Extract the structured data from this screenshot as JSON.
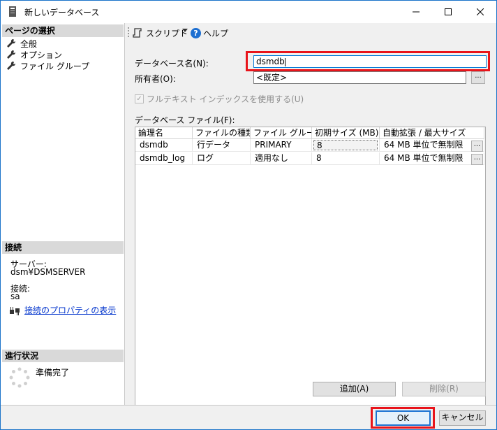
{
  "window": {
    "title": "新しいデータベース",
    "accent_color": "#1a73c9",
    "highlight_color": "#e8141b"
  },
  "left_pane": {
    "page_select_header": "ページの選択",
    "pages": [
      {
        "label": "全般",
        "icon": "wrench-icon"
      },
      {
        "label": "オプション",
        "icon": "wrench-icon"
      },
      {
        "label": "ファイル グループ",
        "icon": "wrench-icon"
      }
    ],
    "connection_header": "接続",
    "server_label": "サーバー:",
    "server_value": "dsm¥DSMSERVER",
    "connection_label": "接続:",
    "connection_value": "sa",
    "connection_properties_link": "接続のプロパティの表示",
    "progress_header": "進行状況",
    "progress_status": "準備完了"
  },
  "toolbar": {
    "script_label": "スクリプト",
    "help_label": "ヘルプ",
    "help_glyph": "?"
  },
  "form": {
    "db_name_label": "データベース名(N):",
    "db_name_value": "dsmdb",
    "owner_label": "所有者(O):",
    "owner_value": "<既定>",
    "browse_glyph": "...",
    "fulltext_label": "フルテキスト インデックスを使用する(U)",
    "fulltext_checked": true,
    "db_files_label": "データベース ファイル(F):"
  },
  "grid": {
    "columns": [
      "論理名",
      "ファイルの種類",
      "ファイル グループ",
      "初期サイズ (MB)",
      "自動拡張 / 最大サイズ"
    ],
    "rows": [
      {
        "logical_name": "dsmdb",
        "file_type": "行データ",
        "filegroup": "PRIMARY",
        "initial_size": "8",
        "autogrowth": "64 MB 単位で無制限"
      },
      {
        "logical_name": "dsmdb_log",
        "file_type": "ログ",
        "filegroup": "適用なし",
        "initial_size": "8",
        "autogrowth": "64 MB 単位で無制限"
      }
    ]
  },
  "buttons": {
    "add": "追加(A)",
    "remove": "削除(R)",
    "ok": "OK",
    "cancel": "キャンセル"
  }
}
